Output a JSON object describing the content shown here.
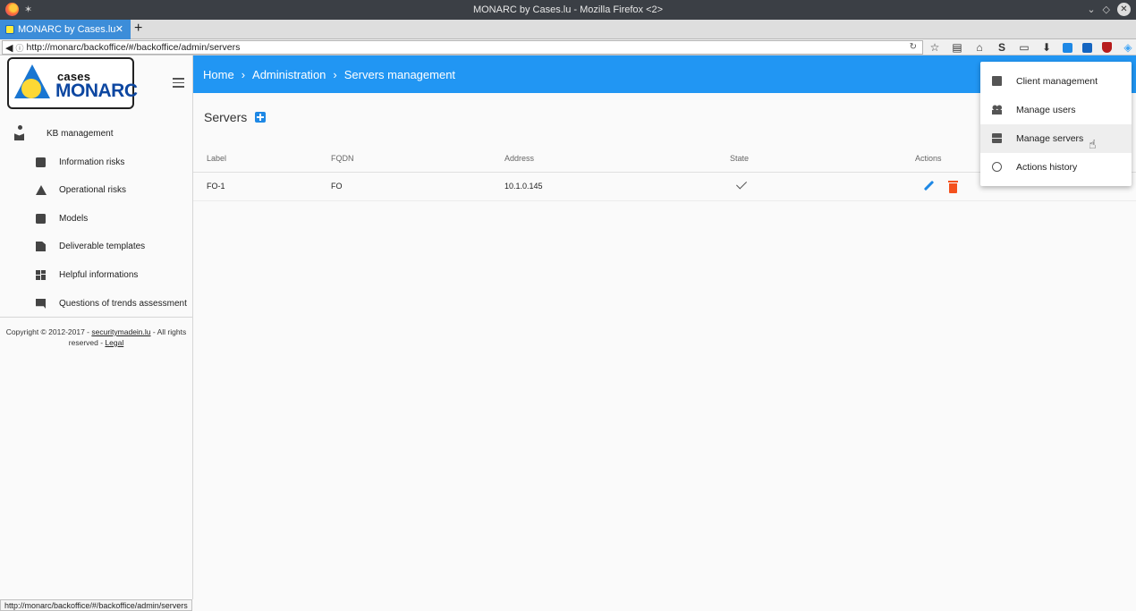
{
  "window": {
    "title": "MONARC by Cases.lu - Mozilla Firefox <2>"
  },
  "browser": {
    "tab_title": "MONARC by Cases.lu",
    "url": "http://monarc/backoffice/#/backoffice/admin/servers",
    "status_url": "http://monarc/backoffice/#/backoffice/admin/servers"
  },
  "logo": {
    "line1": "cases",
    "line2": "MONARC"
  },
  "sidebar": {
    "items": [
      {
        "label": "KB management",
        "icon": "kb-icon"
      },
      {
        "label": "Information risks",
        "icon": "search-doc-icon"
      },
      {
        "label": "Operational risks",
        "icon": "warning-icon"
      },
      {
        "label": "Models",
        "icon": "archive-icon"
      },
      {
        "label": "Deliverable templates",
        "icon": "document-icon"
      },
      {
        "label": "Helpful informations",
        "icon": "dashboard-icon"
      },
      {
        "label": "Questions of trends assessment",
        "icon": "comment-icon"
      }
    ],
    "copyright_prefix": "Copyright © 2012-2017 - ",
    "copyright_link": "securitymadein.lu",
    "copyright_suffix": " - All rights reserved - ",
    "legal_link": "Legal"
  },
  "breadcrumb": {
    "home": "Home",
    "admin": "Administration",
    "current": "Servers management"
  },
  "main": {
    "section_title": "Servers",
    "columns": [
      "Label",
      "FQDN",
      "Address",
      "State",
      "Actions"
    ],
    "rows": [
      {
        "label": "FO-1",
        "fqdn": "FO",
        "address": "10.1.0.145",
        "state": "ok"
      }
    ]
  },
  "menu": {
    "items": [
      {
        "label": "Client management",
        "icon": "client-icon"
      },
      {
        "label": "Manage users",
        "icon": "users-icon"
      },
      {
        "label": "Manage servers",
        "icon": "servers-icon"
      },
      {
        "label": "Actions history",
        "icon": "history-icon"
      }
    ],
    "active_index": 2
  },
  "colors": {
    "accent": "#2196f3",
    "delete": "#f4511e"
  }
}
